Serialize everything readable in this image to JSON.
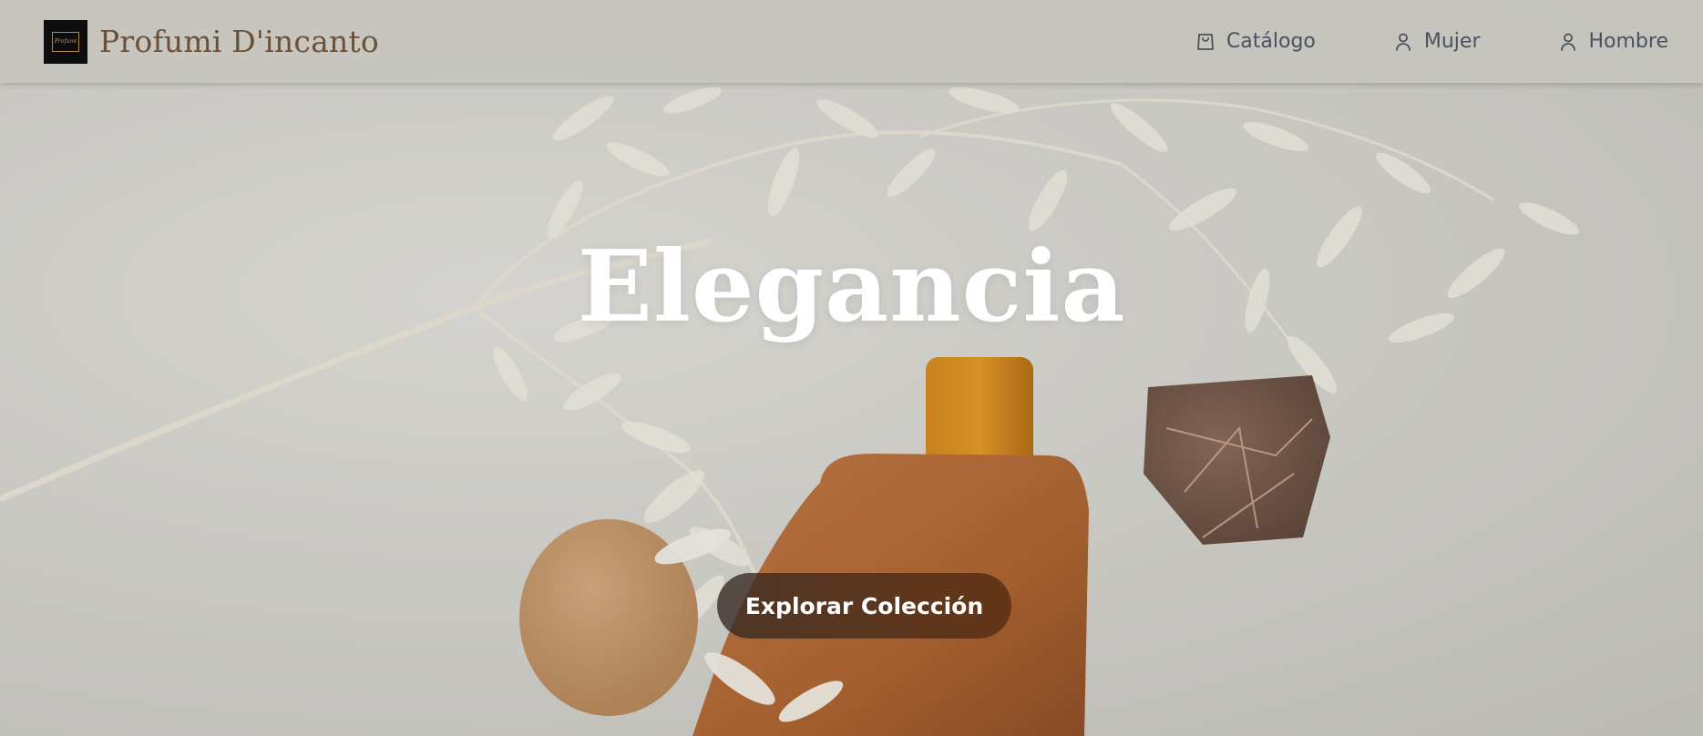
{
  "brand": {
    "logo_text": "Profumi",
    "name": "Profumi D'incanto"
  },
  "nav": {
    "items": [
      {
        "label": "Catálogo",
        "icon": "shopping-bag-icon"
      },
      {
        "label": "Mujer",
        "icon": "user-icon"
      },
      {
        "label": "Hombre",
        "icon": "user-icon"
      }
    ]
  },
  "hero": {
    "title": "Elegancia",
    "cta_label": "Explorar Colección"
  },
  "colors": {
    "brand_text": "#6a5138",
    "nav_text": "#4a5160",
    "header_bg": "#c4c4be",
    "cta_bg": "#4a2d18"
  }
}
